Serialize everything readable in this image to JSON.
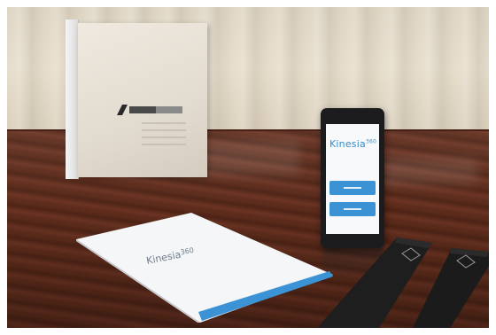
{
  "scene": {
    "manual": {
      "brand": "Kinesia",
      "brand_suffix": "360"
    },
    "phone": {
      "app_brand": "Kinesia",
      "app_brand_suffix": "360"
    },
    "colors": {
      "brand_blue": "#3b93d6",
      "table_wood": "#5a2a1a",
      "wall": "#e2d8c6",
      "strap": "#1e1e1e"
    }
  }
}
